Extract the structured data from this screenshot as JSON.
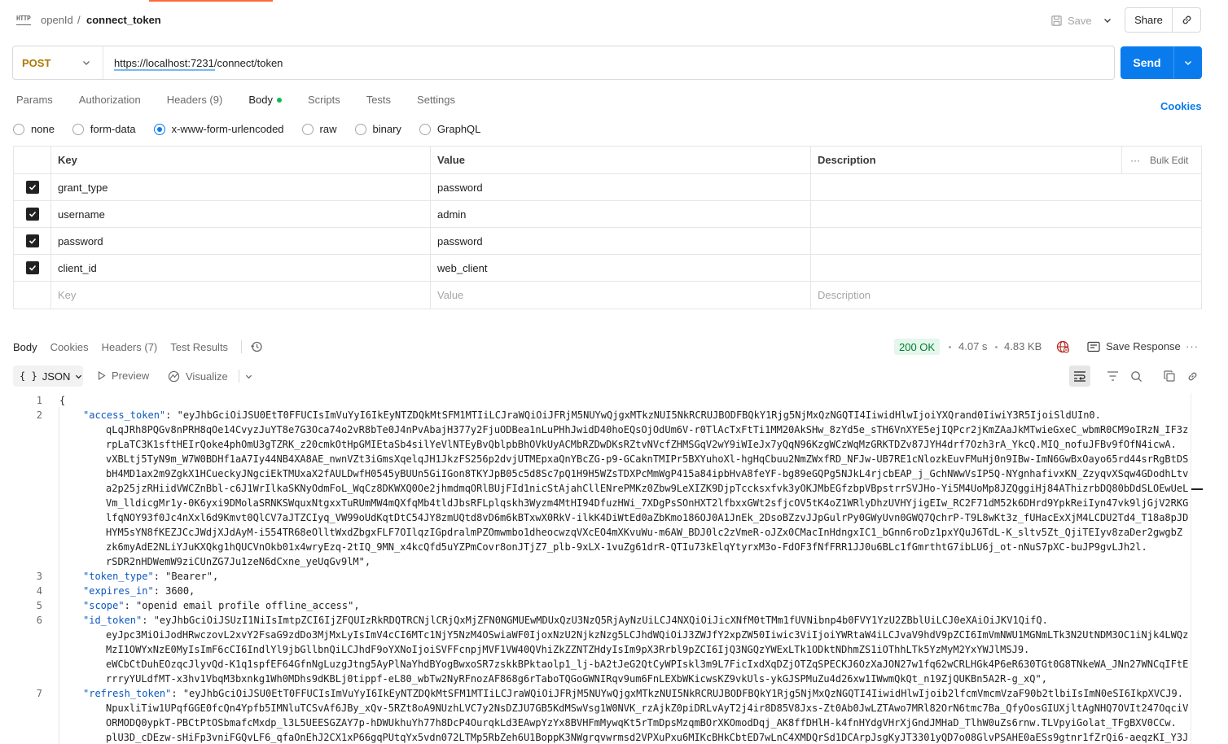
{
  "breadcrumb": {
    "parent": "openId",
    "separator": "/",
    "current": "connect_token",
    "icon": "HTTP"
  },
  "header_actions": {
    "save_label": "Save",
    "share_label": "Share"
  },
  "request": {
    "method": "POST",
    "url": "https://localhost:7231/connect/token",
    "send_label": "Send"
  },
  "request_tabs": [
    {
      "label": "Params"
    },
    {
      "label": "Authorization"
    },
    {
      "label": "Headers (9)"
    },
    {
      "label": "Body"
    },
    {
      "label": "Scripts"
    },
    {
      "label": "Tests"
    },
    {
      "label": "Settings"
    }
  ],
  "cookies_link": "Cookies",
  "body_types": [
    {
      "label": "none"
    },
    {
      "label": "form-data"
    },
    {
      "label": "x-www-form-urlencoded"
    },
    {
      "label": "raw"
    },
    {
      "label": "binary"
    },
    {
      "label": "GraphQL"
    }
  ],
  "params_table": {
    "headers": {
      "key": "Key",
      "value": "Value",
      "description": "Description",
      "bulk_edit": "Bulk Edit"
    },
    "rows": [
      {
        "key": "grant_type",
        "value": "password"
      },
      {
        "key": "username",
        "value": "admin"
      },
      {
        "key": "password",
        "value": "password"
      },
      {
        "key": "client_id",
        "value": "web_client"
      }
    ],
    "placeholders": {
      "key": "Key",
      "value": "Value",
      "description": "Description"
    }
  },
  "response_tabs": [
    {
      "label": "Body"
    },
    {
      "label": "Cookies"
    },
    {
      "label": "Headers (7)"
    },
    {
      "label": "Test Results"
    }
  ],
  "response_meta": {
    "status": "200 OK",
    "time": "4.07 s",
    "size": "4.83 KB",
    "save_response": "Save Response"
  },
  "response_view": {
    "format": "JSON",
    "preview": "Preview",
    "visualize": "Visualize"
  },
  "code_lines": [
    {
      "ln": "1",
      "text": "{"
    },
    {
      "ln": "2",
      "key": "\"access_token\"",
      "rest": ": \"eyJhbGciOiJSU0EtT0FFUCIsImVuYyI6IkEyNTZDQkMtSFM1MTIiLCJraWQiOiJFRjM5NUYwQjgxMTkzNUI5NkRCRUJBODFBQkY1Rjg5NjMxQzNGQTI4IiwidHlwIjoiYXQrand0IiwiY3R5IjoiSldUIn0."
    },
    {
      "ln": "",
      "text": "qLqJRh8PQGv8nPRH8qOe14CvyzJuYT8e7G3Oca74o2vR8bTe0J4nPvAbajH377y2FjuODBea1nLuPHhJwidD40hoEQsOjOdUm6V-r0TlAcTxFtTi1MM20AkSHw_8zYd5e_sTH6VnXYE5ejIQPcr2jKmZAaJkMTwieGxeC_wbmR0CM9oIRzN_IF3z"
    },
    {
      "ln": "",
      "text": "rpLaTC3K1sftHEIrQoke4phOmU3gTZRK_z20cmkOtHpGMIEtaSb4silYeVlNTEyBvQblpbBhOVkUyACMbRZDwDKsRZtvNVcfZHMSGqV2wY9iWIeJx7yQqN96KzgWCzWqMzGRKTDZv87JYH4drf7Ozh3rA_YkcQ.MIQ_nofuJFBv9fOfN4icwA."
    },
    {
      "ln": "",
      "text": "vXBLtj5TyN9m_W7W0BDHf1aA7Iy44NB4XA8AE_nwnVZt3iGmsXqelqJH1JkzFS256p2dvjUTMEpxaQnYBcZG-p9-GCaknTMIPr5BXYuhoXl-hgHqCbuu2NmZWxfRD_NFJw-UB7RE1cNlozkEuvFMuHj0n9IBw-ImN6GwBxOayo65rd44srRgBtDS"
    },
    {
      "ln": "",
      "text": "bH4MD1ax2m9ZgkX1HCueckyJNgciEkTMUxaX2fAULDwfH0545yBUUn5GiIGon8TKYJpB05c5d8Sc7pQ1H9H5WZsTDXPcMmWgP415a84ipbHvA8feYF-bg89eGQPg5NJkL4rjcbEAP_j_GchNWwVsIP5Q-NYgnhafivxKN_ZzyqvXSqw4GDodhLtv"
    },
    {
      "ln": "",
      "text": "a2p25jzRHiidVWCZnBbl-c6J1WrIlkaSKNyOdmFoL_WqCz8DKWXQ0Oe2jhmdmqORlBUjFId1nicStAjahCllENrePMKz0Zbw9LeXIZK9DjpTccksxfvk3yOKJMbEGfzbpVBpstrrSVJHo-Yi5M4UoMp8JZQggiHj84AThizrbDQ80bDdSLOEwUeL"
    },
    {
      "ln": "",
      "text": "Vm_lldicgMr1y-0K6yxi9DMolaSRNKSWquxNtgxxTuRUmMW4mQXfqMb4tldJbsRFLplqskh3Wyzm4MtHI94DfuzHWi_7XDgPsSOnHXT2lfbxxGWt2sfjcOV5tK4oZ1WRlyDhzUVHYjigEIw_RC2F71dM52k6DHrd9YpkReiIyn47vk9ljGjV2RKG"
    },
    {
      "ln": "",
      "text": "lfqNOY93f0Jc4nXxl6d9Kmvt0QlCV7aJTZCIyq_VW99oUdKqtDtC54JY8zmUQtd8vD6m6kBTxwX0RkV-ilkK4DiWtEd0aZbKmo186OJ0A1JnEk_2DsoBZzvJJpGulrPy0GWyUvn0GWQ7QchrP-T9L8wKt3z_fUHacExXjM4LCDU2Td4_T18a8pJD"
    },
    {
      "ln": "",
      "text": "HYM5sYN8fKEZJCcJWdjXJdAyM-i554TR68eOlltWxdZbgxFLF7OIlqzIGpdralmPZOmwmbo1dheocwzqVXcEO4mXKvuWu-m6AW_BDJ0lc2zVmeR-oJZx0CMacInHdngxIC1_bGnn6roDz1pxYQuJ6TdL-K_sltv5Zt_QjiTEIyv8zaDer2gwgbZ"
    },
    {
      "ln": "",
      "text": "zk6myAdE2NLiYJuKXQkg1hQUCVnOkb01x4wryEzq-2tIQ_9MN_x4kcQfd5uYZPmCovr8onJTjZ7_plb-9xLX-1vuZg61drR-QTIu73kElqYtyrxM3o-FdOF3fNfFRR1JJ0u6BLc1fGmrthtG7ibLU6j_ot-nNuS7pXC-buJP9gvLJh2l."
    },
    {
      "ln": "",
      "text": "rSDR2nHDWemW9ziCUnZG7Ju1zeN6dCxne_yeUqGv9lM\","
    },
    {
      "ln": "3",
      "key": "\"token_type\"",
      "rest": ": \"Bearer\","
    },
    {
      "ln": "4",
      "key": "\"expires_in\"",
      "rest": ": 3600,"
    },
    {
      "ln": "5",
      "key": "\"scope\"",
      "rest": ": \"openid email profile offline_access\","
    },
    {
      "ln": "6",
      "key": "\"id_token\"",
      "rest": ": \"eyJhbGciOiJSUzI1NiIsImtpZCI6IjZFQUIzRkRDQTRCNjlCRjQxMjZFN0NGMUEwMDUxQzU3NzQ5RjAyNzUiLCJ4NXQiOiJicXNfM0tTMm1fUVNibnp4b0FVY1YzU2ZBblUiLCJ0eXAiOiJKV1QifQ."
    },
    {
      "ln": "",
      "text": "eyJpc3MiOiJodHRwczovL2xvY2FsaG9zdDo3MjMxLyIsImV4cCI6MTc1NjY5NzM4OSwiaWF0IjoxNzU2NjkzNzg5LCJhdWQiOiJ3ZWJfY2xpZW50Iiwic3ViIjoiYWRtaW4iLCJvaV9hdV9pZCI6ImVmNWU1MGNmLTk3N2UtNDM3OC1iNjk4LWQz"
    },
    {
      "ln": "",
      "text": "MzI1OWYxNzE0MyIsImF6cCI6IndlYl9jbGllbnQiLCJhdF9oYXNoIjoiSVFFcnpjMVF1VW40QVhiZkZZNTZHdyIsIm9pX3Rrbl9pZCI6IjQ3NGQzYWExLTk1ODktNDhmZS1iOThhLTk5YzMyM2YxYWJlMSJ9."
    },
    {
      "ln": "",
      "text": "eWCbCtDuhEOzqcJlyvQd-K1q1spfEF64GfnNgLuzgJtng5AyPlNaYhdBYogBwxoSR7zskkBPktaolp1_lj-bA2tJeG2QtCyWPIskl3m9L7FicIxdXqDZjOTZqSPECKJ6OzXaJON27w1fq62wCRLHGk4P6eR630TGt0G8TNkeWA_JNn27WNCqIFtE"
    },
    {
      "ln": "",
      "text": "rrryYULdfMT-x3hv1VbqM3bxnkg1Wh0MDhs9dKBLj0tippf-eL80_wbTw2NyRFnozAF868g6rTaboTQGoGWNIRqv9um6FnLEXbWKicwsKZ9vkUls-ykGJSPMuZu4d26xw1IWwmQkQt_n19ZjQUKBn5A2R-g_xQ\","
    },
    {
      "ln": "7",
      "key": "\"refresh_token\"",
      "rest": ": \"eyJhbGciOiJSU0EtT0FFUCIsImVuYyI6IkEyNTZDQkMtSFM1MTIiLCJraWQiOiJFRjM5NUYwQjgxMTkzNUI5NkRCRUJBODFBQkY1Rjg5NjMxQzNGQTI4IiwidHlwIjoib2lfcmVmcmVzaF90b2tlbiIsImN0eSI6IkpXVCJ9."
    },
    {
      "ln": "",
      "text": "NpuxliTiw1UPqfGGE0fcQn4Ypfb5IMNluTCSvAf6JBy_xQv-5RZt8oA9NUzhLVC7y2NsDZJU7GB5KdMSwVsg1W0NVK_rzAjkZ0piDRLvAyT2j4ir8D85V8Jxs-Zt0Ab0JwLZTAwo7MRl82OrN6tmc7Ba_QfyOosGIUXjltAgNHQ7OVIt247OqciV"
    },
    {
      "ln": "",
      "text": "ORMODQ0ypkT-PBCtPtOSbmafcMxdp_l3L5UEESGZAY7p-hDWUkhuYh77h8DcP4OurqkLd3EAwpYzYx8BVHFmMywqKt5rTmDpsMzqmBOrXKOmodDqj_AK8ffDHlH-k4fnHYdgVHrXjGndJMHaD_TlhW0uZs6rnw.TLVpyiGolat_TFgBXV0CCw."
    },
    {
      "ln": "",
      "text": "plU3D_cDEzw-sHiFp3vniFGQvLF6_qfaOnEhJ2CX1xP66gqPUtqYx5vdn072LTMp5RbZeh6U1BoppK3NWgrqvwrmsd2VPXuPxu6MIKcBHkCbtED7wLnC4XMDQrSd1DCArpJsgKyJT3301yQD7o08GlvPSAHE0aESs9gtnr1fZrQi6-aeqzKI_Y3J"
    }
  ]
}
